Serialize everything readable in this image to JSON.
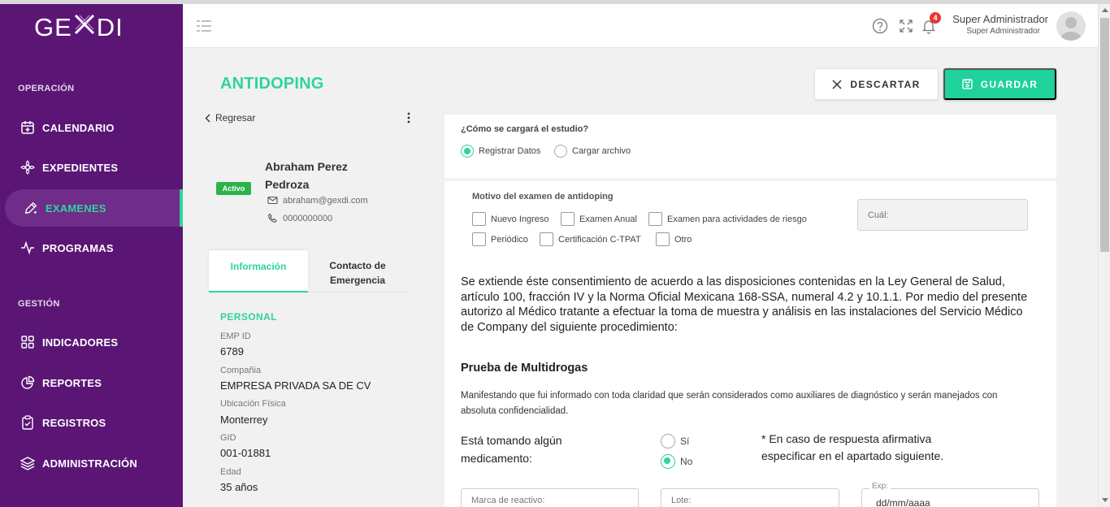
{
  "brand": {
    "logo_left": "GE",
    "logo_right": "DI"
  },
  "sidebar": {
    "section_operacion": "OPERACIÓN",
    "section_gestion": "GESTIÓN",
    "items": [
      {
        "label": "CALENDARIO",
        "icon": "calendar-icon"
      },
      {
        "label": "EXPEDIENTES",
        "icon": "flower-icon"
      },
      {
        "label": "EXAMENES",
        "icon": "pencil-icon",
        "active": true
      },
      {
        "label": "PROGRAMAS",
        "icon": "activity-icon"
      },
      {
        "label": "INDICADORES",
        "icon": "grid-icon"
      },
      {
        "label": "REPORTES",
        "icon": "pie-icon"
      },
      {
        "label": "REGISTROS",
        "icon": "clipboard-icon"
      },
      {
        "label": "ADMINISTRACIÓN",
        "icon": "layers-icon"
      }
    ]
  },
  "topbar": {
    "notifications_count": "4",
    "user_name": "Super Administrador",
    "user_role": "Super Administrador"
  },
  "page": {
    "title": "ANTIDOPING",
    "discard_label": "DESCARTAR",
    "save_label": "GUARDAR"
  },
  "profile": {
    "back_label": "Regresar",
    "status": "Activo",
    "name": "Abraham Perez Pedroza",
    "email": "abraham@gexdi.com",
    "phone": "0000000000",
    "tabs": [
      "Información",
      "Contacto de Emergencia"
    ],
    "section": "PERSONAL",
    "fields": [
      {
        "label": "EMP ID",
        "value": "6789"
      },
      {
        "label": "Compañia",
        "value": "EMPRESA PRIVADA SA DE CV"
      },
      {
        "label": "Ubicación Física",
        "value": "Monterrey"
      },
      {
        "label": "GID",
        "value": "001-01881"
      },
      {
        "label": "Edad",
        "value": "35 años"
      }
    ]
  },
  "form": {
    "load_question": "¿Cómo se cargará el estudio?",
    "load_options": [
      "Registrar Datos",
      "Cargar archivo"
    ],
    "load_selected": "Registrar Datos",
    "motivo_label": "Motivo del examen de antidoping",
    "motivos": [
      "Nuevo Ingreso",
      "Examen Anual",
      "Examen para actividades de riesgo",
      "Periódico",
      "Certificación C-TPAT",
      "Otro"
    ],
    "cual_placeholder": "Cuál:",
    "consent_text": "Se extiende éste consentimiento de acuerdo a las disposiciones contenidas en la Ley General de Salud, artículo 100, fracción IV y la Norma Oficial Mexicana 168-SSA, numeral 4.2 y 10.1.1. Por medio del presente autorizo al Médico tratante a efectuar la toma de muestra y análisis en las instalaciones del Servicio Médico de Company del siguiente procedimiento:",
    "test_title": "Prueba de Multidrogas",
    "manifest_text": "Manifestando que fui informado con toda claridad que serán considerados como auxiliares de diagnóstico y serán manejados con absoluta confidencialidad.",
    "medication_question": "Está tomando algún medicamento:",
    "medication_options": [
      "Sí",
      "No"
    ],
    "medication_selected": "No",
    "medication_note": "* En caso de respuesta afirmativa especificar en el apartado siguiente.",
    "reactivo_placeholder": "Marca de reactivo:",
    "lote_placeholder": "Lote:",
    "exp_label": "Exp:",
    "date_placeholder": "dd/mm/aaaa"
  }
}
